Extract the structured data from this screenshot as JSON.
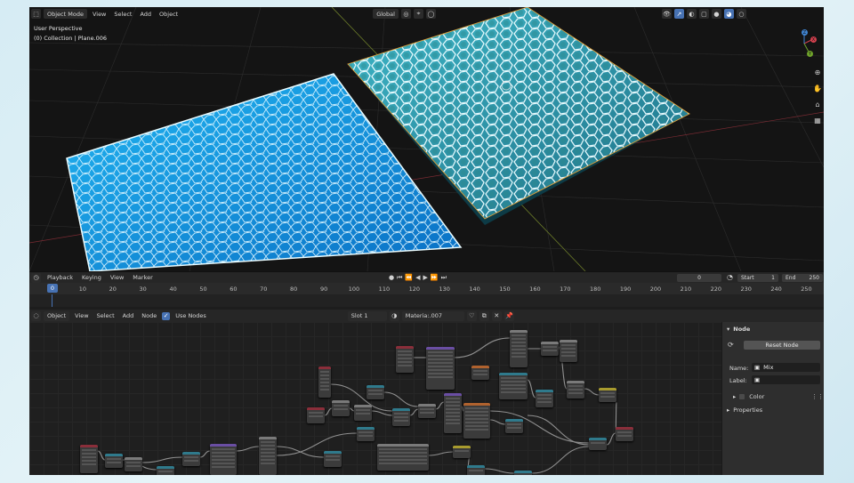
{
  "viewport": {
    "editor_type": "3D Viewport",
    "mode": "Object Mode",
    "menus": [
      "View",
      "Select",
      "Add",
      "Object"
    ],
    "transform_orientation": "Global",
    "info_line1": "User Perspective",
    "info_line2": "(0) Collection | Plane.006",
    "gizmo_axes": [
      "X",
      "Y",
      "Z"
    ]
  },
  "timeline": {
    "menus": [
      "Playback",
      "Keying",
      "View",
      "Marker"
    ],
    "current_frame": "0",
    "start_label": "Start",
    "start_value": "1",
    "end_label": "End",
    "end_value": "250",
    "ticks": [
      "0",
      "10",
      "20",
      "30",
      "40",
      "50",
      "60",
      "70",
      "80",
      "90",
      "100",
      "110",
      "120",
      "130",
      "140",
      "150",
      "160",
      "170",
      "180",
      "190",
      "200",
      "210",
      "220",
      "230",
      "240",
      "250"
    ],
    "frame_marker": "0"
  },
  "node_editor": {
    "object_type": "Object",
    "menus": [
      "View",
      "Select",
      "Add",
      "Node"
    ],
    "use_nodes_label": "Use Nodes",
    "slot": "Slot 1",
    "material": "Materia:.007"
  },
  "sidebar": {
    "panel_title": "Node",
    "reset_button": "Reset Node",
    "name_label": "Name:",
    "name_value": "Mix",
    "label_label": "Label:",
    "label_value": "",
    "color_label": "Color",
    "properties_label": "Properties"
  },
  "colors": {
    "accent": "#4772b3",
    "water": "#0f8fd6",
    "selection_outline": "#e0a03a"
  }
}
